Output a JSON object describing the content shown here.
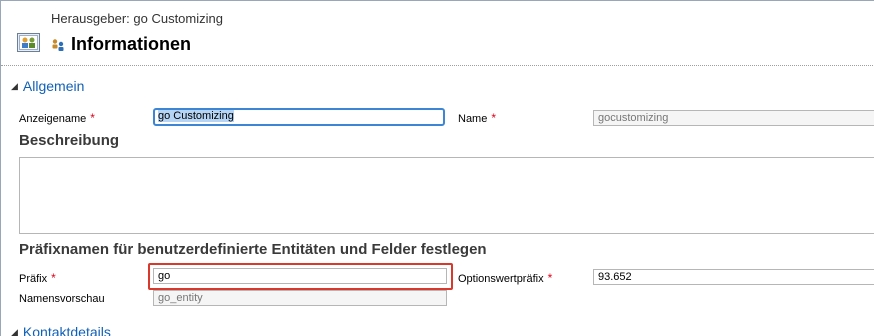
{
  "header": {
    "publisher_line": "Herausgeber: go Customizing",
    "title": "Informationen"
  },
  "sections": {
    "general": "Allgemein",
    "contact": "Kontaktdetails"
  },
  "form": {
    "display_name_label": "Anzeigename",
    "display_name_value": "go Customizing",
    "name_label": "Name",
    "name_value": "gocustomizing",
    "description_heading": "Beschreibung",
    "prefix_heading": "Präfixnamen für benutzerdefinierte Entitäten und Felder festlegen",
    "prefix_label": "Präfix",
    "prefix_value": "go",
    "option_prefix_label": "Optionswertpräfix",
    "option_prefix_value": "93.652",
    "preview_label": "Namensvorschau",
    "preview_value": "go_entity",
    "required_marker": "*"
  },
  "icons": {
    "entity": "publisher-entity-icon",
    "small": "users-icon",
    "collapse": "triangle-down-icon"
  },
  "colors": {
    "link": "#1160b7",
    "required": "#e2001a",
    "focus_border": "#3d86d6",
    "highlight_border": "#d8392b"
  }
}
